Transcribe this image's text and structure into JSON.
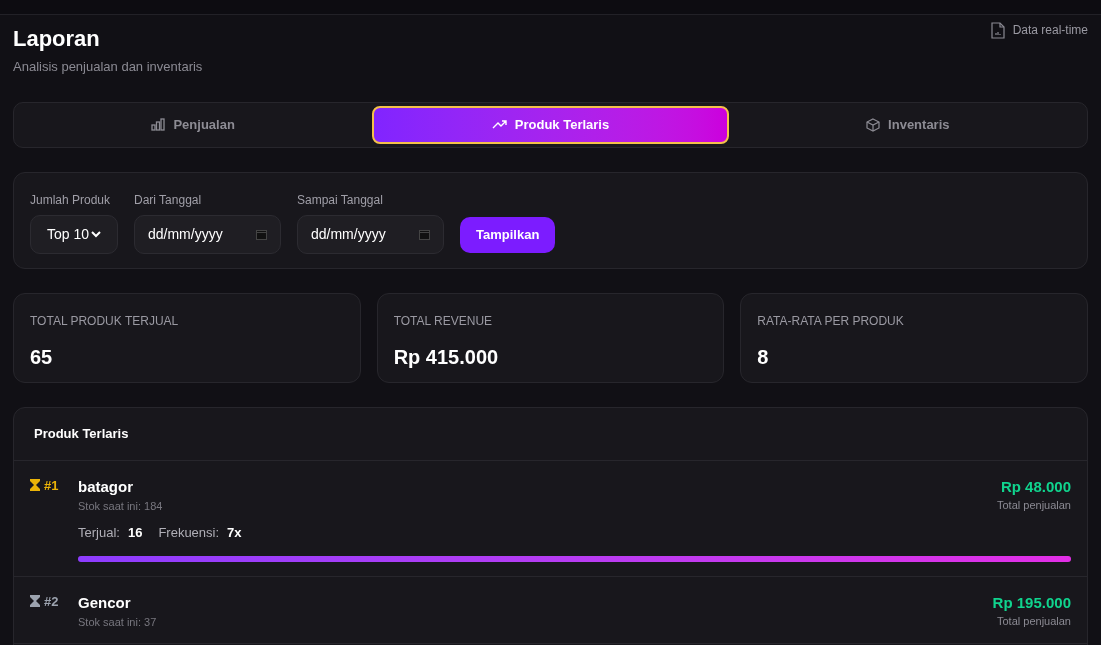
{
  "header": {
    "title": "Laporan",
    "subtitle": "Analisis penjualan dan inventaris",
    "badge": "Data real-time"
  },
  "tabs": [
    {
      "label": "Penjualan",
      "selected": false
    },
    {
      "label": "Produk Terlaris",
      "selected": true
    },
    {
      "label": "Inventaris",
      "selected": false
    }
  ],
  "filters": {
    "count": {
      "label": "Jumlah Produk",
      "value": "Top 10"
    },
    "from": {
      "label": "Dari Tanggal",
      "placeholder": "dd/mm/yyyy"
    },
    "to": {
      "label": "Sampai Tanggal",
      "placeholder": "dd/mm/yyyy"
    },
    "button": "Tampilkan"
  },
  "stats": [
    {
      "label": "TOTAL PRODUK TERJUAL",
      "value": "65"
    },
    {
      "label": "TOTAL REVENUE",
      "value": "Rp 415.000"
    },
    {
      "label": "RATA-RATA PER PRODUK",
      "value": "8"
    }
  ],
  "list": {
    "title": "Produk Terlaris",
    "items": [
      {
        "rank": "#1",
        "color": "#eab308",
        "name": "batagor",
        "stock": "Stok saat ini: 184",
        "sold_label": "Terjual:",
        "sold": "16",
        "freq_label": "Frekuensi:",
        "freq": "7x",
        "amount": "Rp 48.000",
        "amount_label": "Total penjualan",
        "level": 1
      },
      {
        "rank": "#2",
        "color": "#9ca3af",
        "name": "Gencor",
        "stock": "Stok saat ini: 37",
        "amount": "Rp 195.000",
        "amount_label": "Total penjualan"
      }
    ]
  }
}
